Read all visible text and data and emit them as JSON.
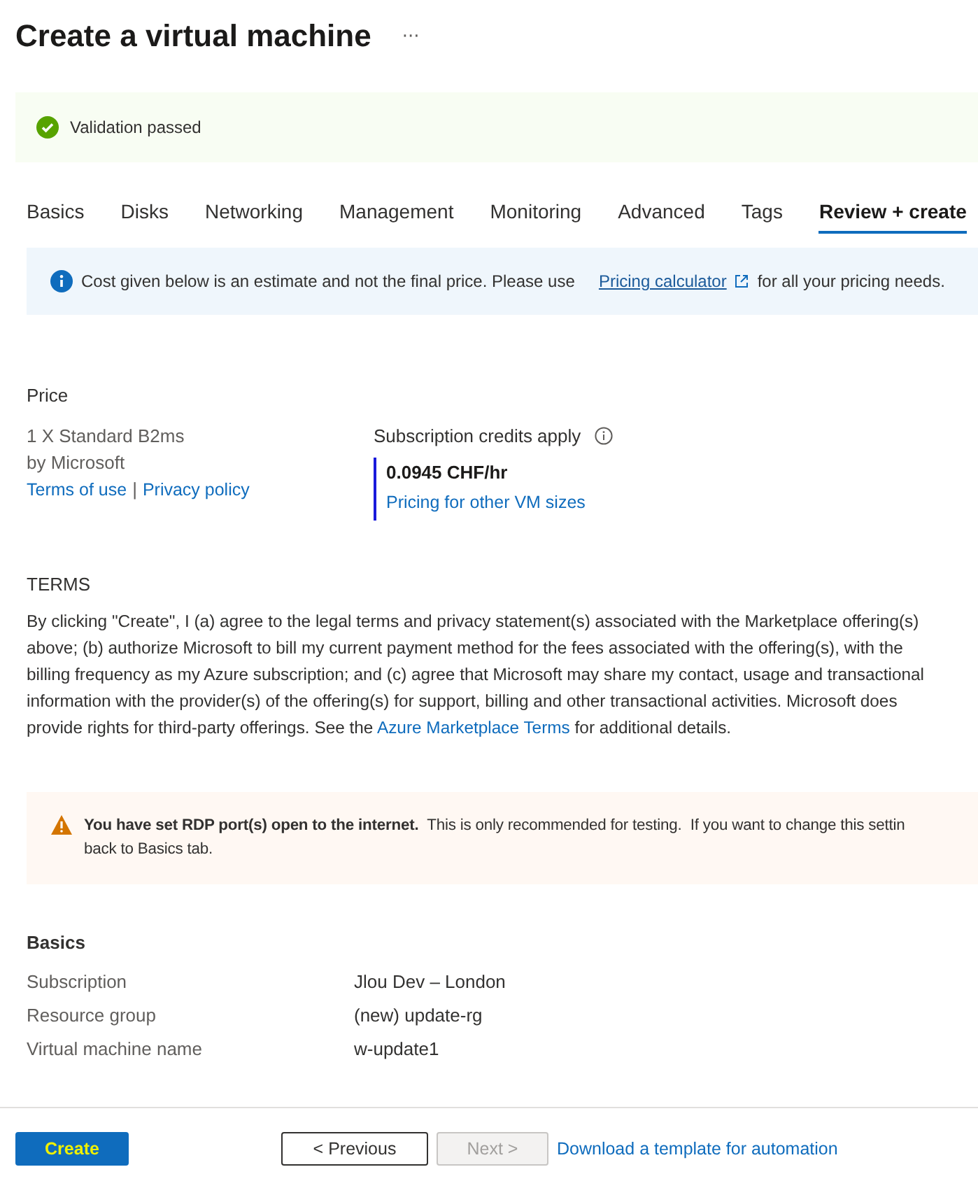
{
  "title": "Create a virtual machine",
  "more": "···",
  "validation": {
    "text": "Validation passed",
    "passed": true
  },
  "tabs": [
    {
      "label": "Basics",
      "selected": false
    },
    {
      "label": "Disks",
      "selected": false
    },
    {
      "label": "Networking",
      "selected": false
    },
    {
      "label": "Management",
      "selected": false
    },
    {
      "label": "Monitoring",
      "selected": false
    },
    {
      "label": "Advanced",
      "selected": false
    },
    {
      "label": "Tags",
      "selected": false
    },
    {
      "label": "Review + create",
      "selected": true
    }
  ],
  "info": {
    "text_before": "Cost given below is an estimate and not the final price. Please use",
    "link": "Pricing calculator",
    "text_after": "for all your pricing needs."
  },
  "price": {
    "heading": "Price",
    "product": "1 X Standard B2ms",
    "publisher": "by Microsoft",
    "terms_link": "Terms of use",
    "separator": "|",
    "privacy_link": "Privacy policy",
    "credits": "Subscription credits apply",
    "amount": "0.0945 CHF/hr",
    "other_sizes": "Pricing for other VM sizes"
  },
  "terms": {
    "heading": "TERMS",
    "lines": [
      "By clicking \"Create\", I (a) agree to the legal terms and privacy statement(s) associated with the Marketplace offering(s)",
      "above; (b) authorize Microsoft to bill my current payment method for the fees associated with the offering(s), with the",
      "billing frequency as my Azure subscription; and (c) agree that Microsoft may share my contact, usage and transactional",
      "information with the provider(s) of the offering(s) for support, billing and other transactional activities. Microsoft does"
    ],
    "last_before": "provide rights for third-party offerings. See the",
    "last_link": "Azure Marketplace Terms",
    "last_after": "for additional details."
  },
  "warning": {
    "lines": [
      "**You have set RDP port(s) open to the internet.**  This is only recommended for testing.  If you want to change this settin",
      "back to Basics tab."
    ]
  },
  "basics": {
    "heading": "Basics",
    "rows": [
      {
        "label": "Subscription",
        "value": "Jlou Dev – London"
      },
      {
        "label": "Resource group",
        "value": "(new) update-rg"
      },
      {
        "label": "Virtual machine name",
        "value": "w-update1"
      }
    ]
  },
  "footer": {
    "create": "Create",
    "previous": "< Previous",
    "next": {
      "label": "Next >",
      "disabled": true
    },
    "download": "Download a template for automation"
  }
}
